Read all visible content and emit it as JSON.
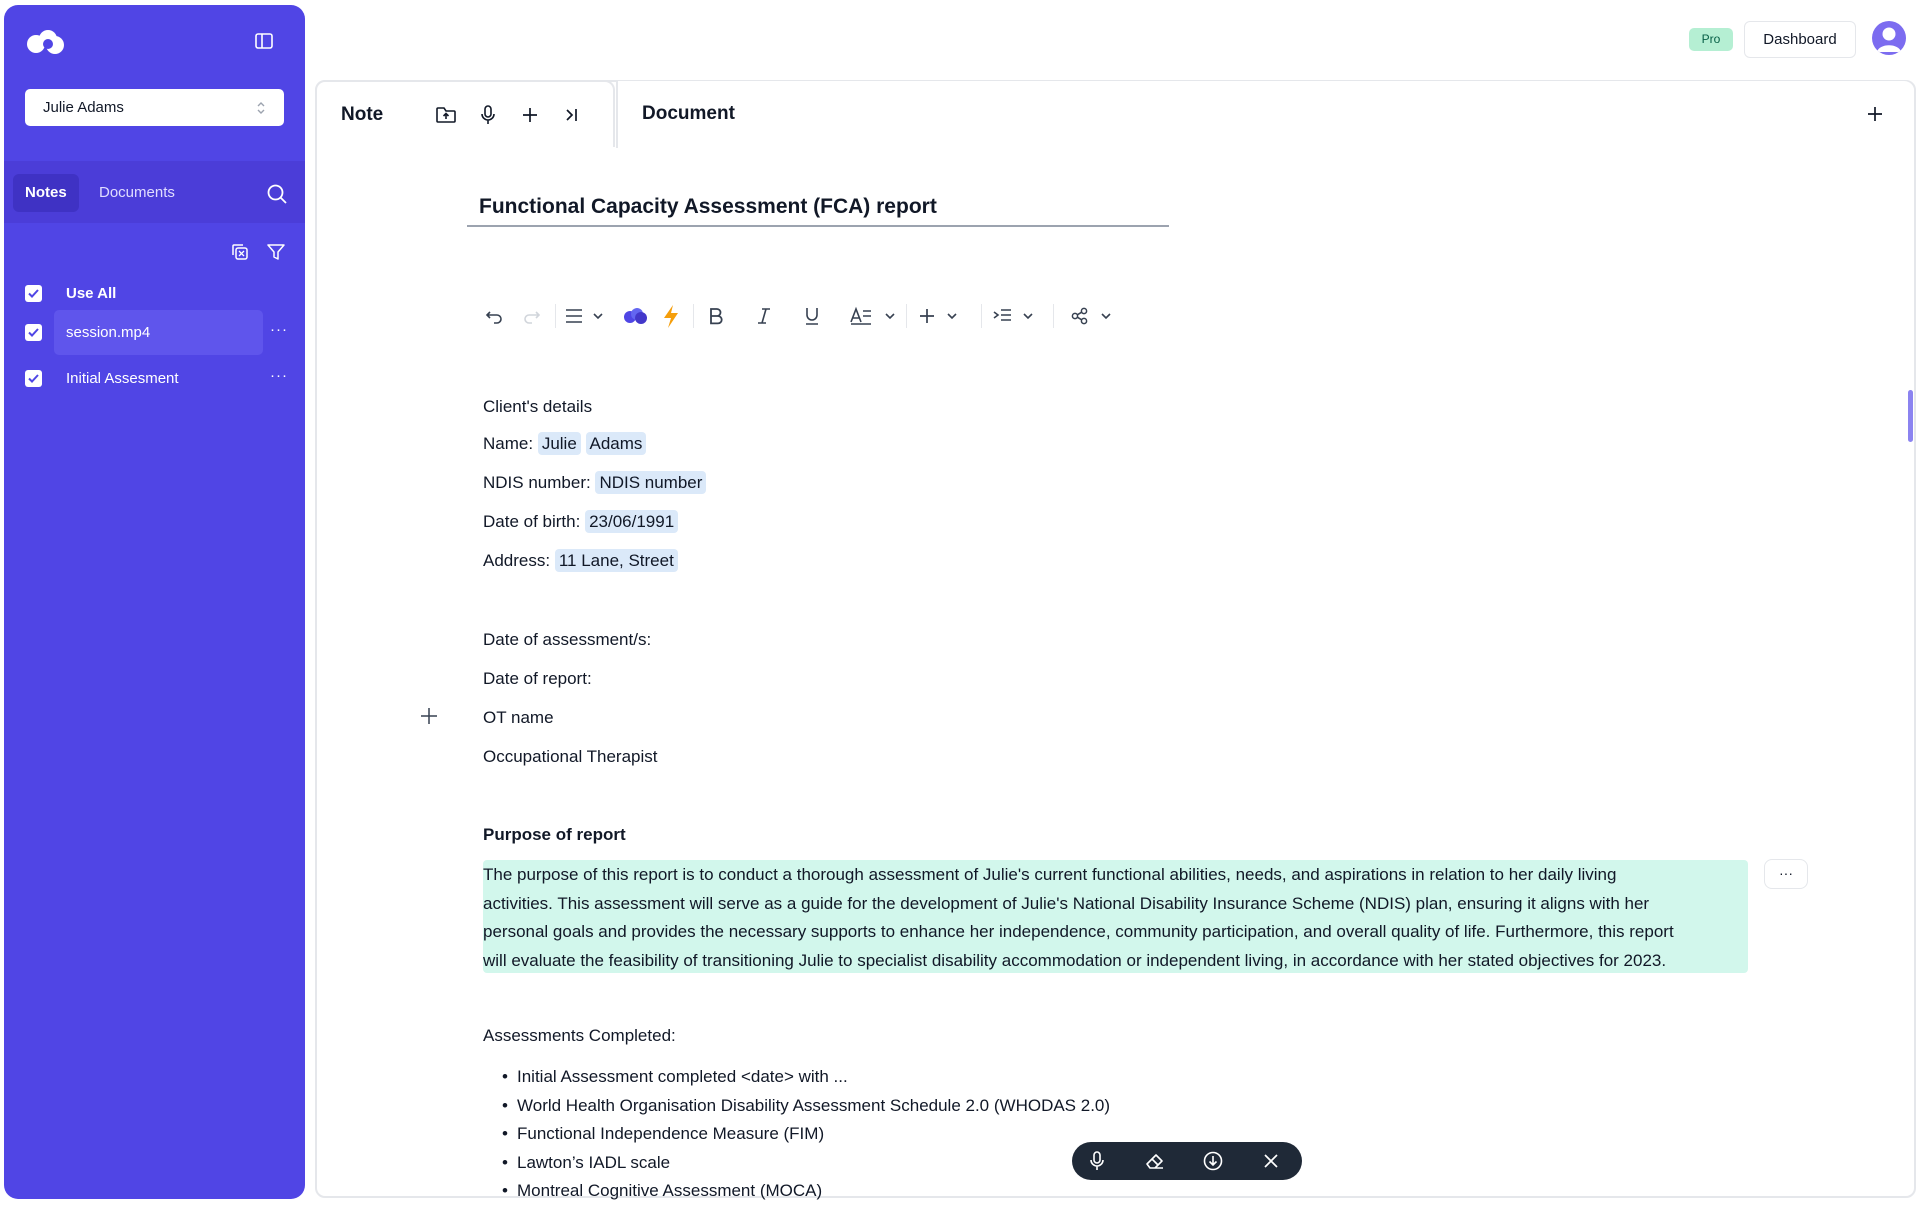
{
  "sidebar": {
    "user_select": "Julie Adams",
    "tabs": [
      {
        "label": "Notes"
      },
      {
        "label": "Documents"
      }
    ],
    "rows": [
      {
        "label": "Use All",
        "checked": true
      },
      {
        "label": "session.mp4",
        "checked": true
      },
      {
        "label": "Initial Assesment",
        "checked": true
      }
    ],
    "more": "···"
  },
  "topbar": {
    "pro_badge": "Pro",
    "dashboard": "Dashboard"
  },
  "note_panel": {
    "title": "Note"
  },
  "doc_panel": {
    "title": "Document"
  },
  "document": {
    "name": "Functional Capacity Assessment (FCA) report",
    "client_details": "Client's details",
    "name_label": "Name:",
    "first_name": "Julie",
    "last_name": "Adams",
    "ndis_label": "NDIS number:",
    "ndis_value": "NDIS number",
    "dob_label": "Date of birth:",
    "dob_value": "23/06/1991",
    "address_label": "Address:",
    "address_value": "11 Lane, Street",
    "date_assessment": "Date of assessment/s:",
    "date_report": "Date of report:",
    "ot_name": "OT name",
    "ot_role": "Occupational Therapist",
    "purpose_heading": "Purpose of report",
    "purpose_lines": [
      "The purpose of this report is to conduct a thorough assessment of Julie's current functional abilities, needs, and aspirations in relation to her daily living",
      "activities. This assessment will serve as a guide for the development of Julie's National Disability Insurance Scheme (NDIS) plan, ensuring it aligns with her",
      "personal goals and provides the necessary supports to enhance her independence, community participation, and overall quality of life. Furthermore, this report",
      "will evaluate the feasibility of transitioning Julie to specialist disability accommodation or independent living, in accordance with her stated objectives for 2023."
    ],
    "assessments_heading": "Assessments Completed:",
    "assessments": [
      "Initial Assessment completed <date> with ...",
      "World Health Organisation Disability Assessment Schedule 2.0 (WHODAS 2.0)",
      "Functional Independence Measure (FIM)",
      "Lawton’s IADL scale",
      "Montreal Cognitive Assessment (MOCA)"
    ],
    "para_more": "···"
  },
  "colors": {
    "sidebar": "#5045e5",
    "accent": "#4f46e5",
    "highlight": "#d2f7ec",
    "chip": "#dbe9f9"
  }
}
